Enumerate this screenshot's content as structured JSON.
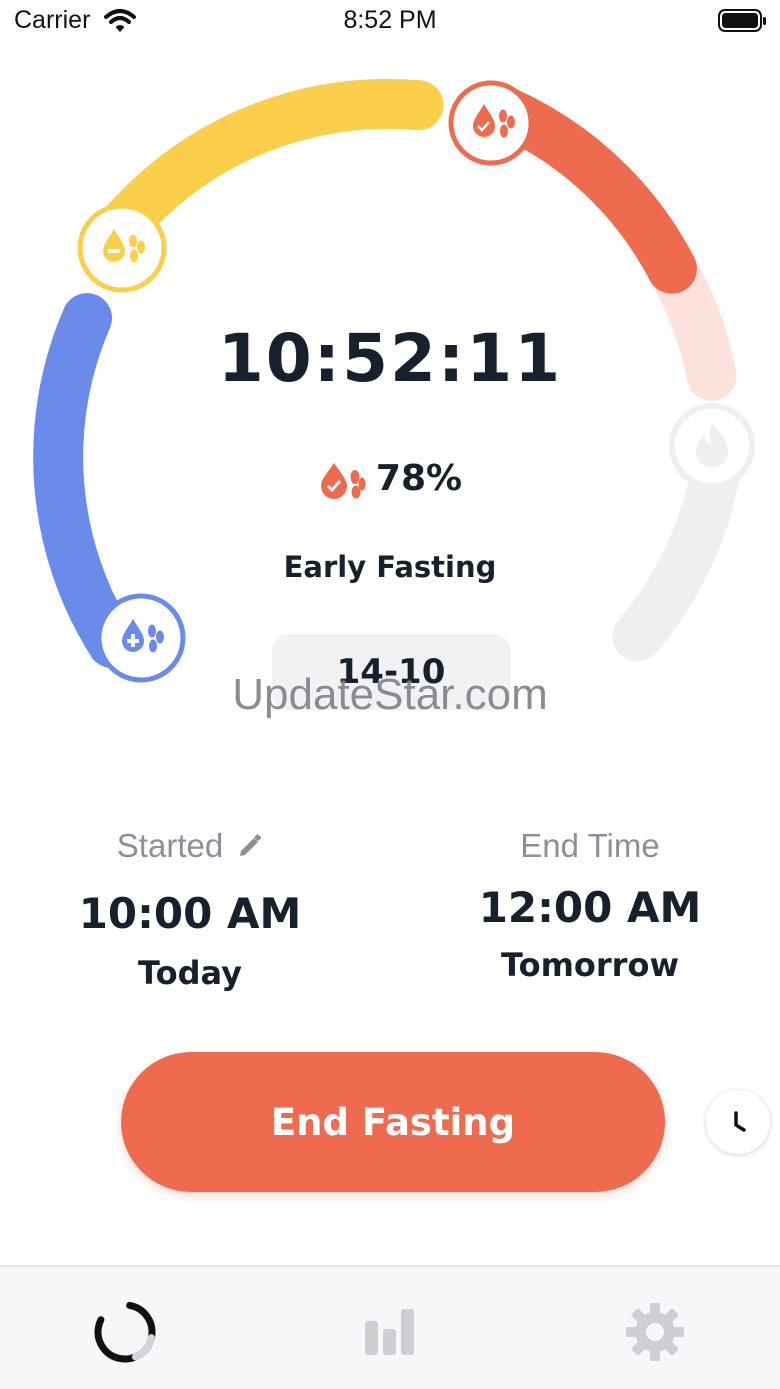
{
  "status_bar": {
    "carrier": "Carrier",
    "time": "8:52 PM"
  },
  "timer": {
    "elapsed": "10:52:11",
    "progress": "78%",
    "phase": "Early Fasting",
    "plan": "14-10"
  },
  "watermark": "UpdateStar.com",
  "started": {
    "label": "Started",
    "time": "10:00 AM",
    "day": "Today"
  },
  "end": {
    "label": "End Time",
    "time": "12:00 AM",
    "day": "Tomorrow"
  },
  "actions": {
    "end_fasting": "End Fasting"
  },
  "tabs": [
    {
      "icon": "timer-ring-icon",
      "active": true
    },
    {
      "icon": "bar-chart-icon",
      "active": false
    },
    {
      "icon": "gear-icon",
      "active": false
    }
  ],
  "colors": {
    "accent": "#ef6b4f",
    "blue_stage": "#6b8bea",
    "yellow_stage": "#fccf4b",
    "red_stage": "#ef6b4f",
    "inactive_stage": "#efeff2",
    "text": "#17202d",
    "muted_text": "#8a909b"
  },
  "fasting_progress_fraction": 0.78
}
